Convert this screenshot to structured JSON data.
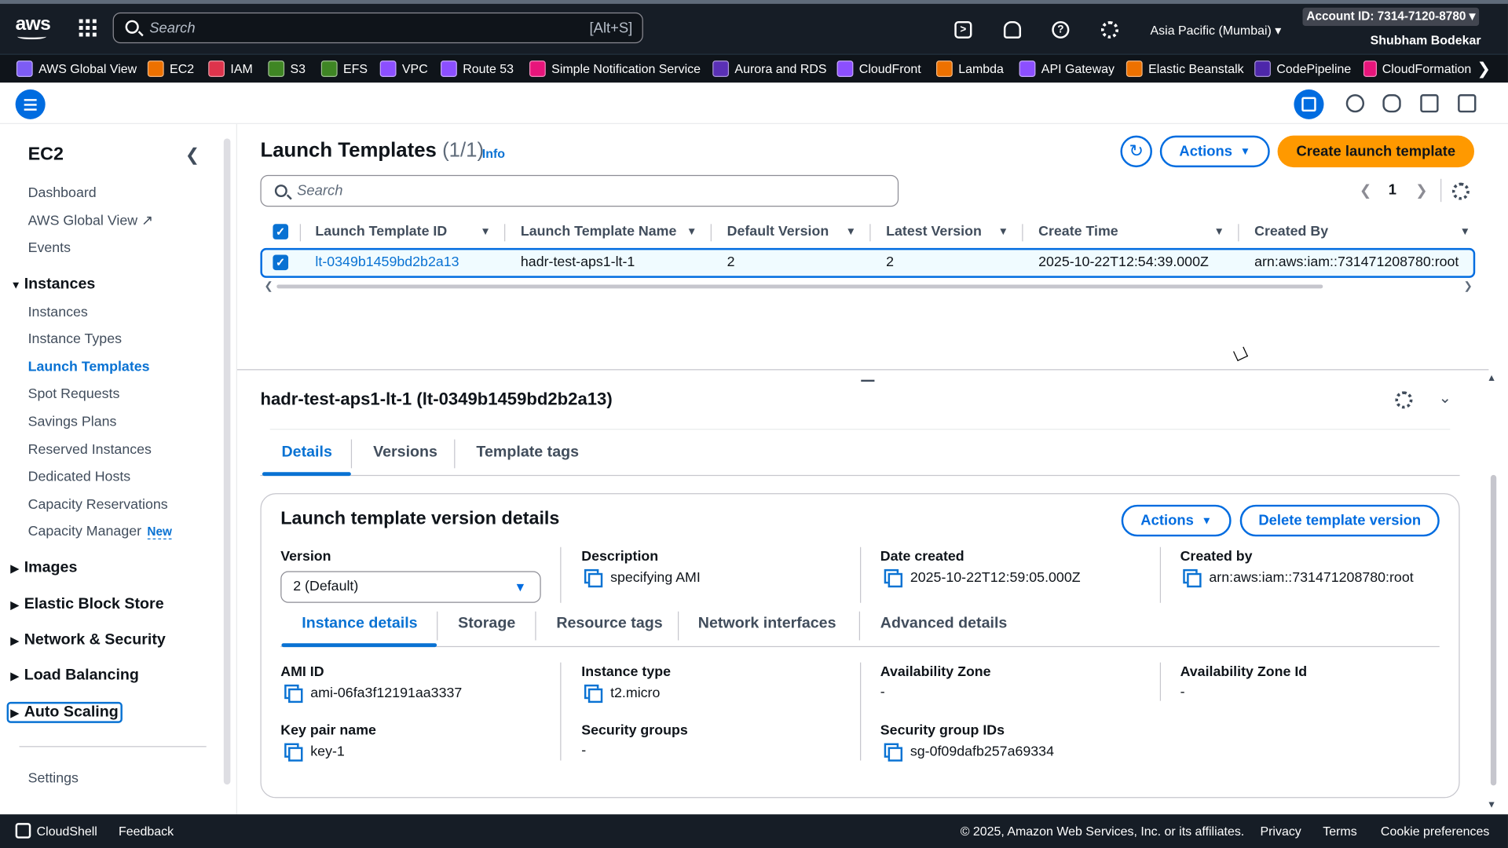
{
  "topnav": {
    "search_placeholder": "Search",
    "search_shortcut": "[Alt+S]",
    "region": "Asia Pacific (Mumbai) ▾",
    "account": "Account ID: 7314-7120-8780 ▾",
    "user": "Shubham Bodekar",
    "icons": [
      "cloudshell-icon",
      "bell-icon",
      "help-icon",
      "gear-icon"
    ]
  },
  "favorites": [
    {
      "label": "AWS Global View",
      "color": "#7d5cf5"
    },
    {
      "label": "EC2",
      "color": "#ed7100"
    },
    {
      "label": "IAM",
      "color": "#dd344c"
    },
    {
      "label": "S3",
      "color": "#3f8624"
    },
    {
      "label": "EFS",
      "color": "#3f8624"
    },
    {
      "label": "VPC",
      "color": "#8c4fff"
    },
    {
      "label": "Route 53",
      "color": "#8c4fff"
    },
    {
      "label": "Simple Notification Service",
      "color": "#e7157b"
    },
    {
      "label": "Aurora and RDS",
      "color": "#5a30b5"
    },
    {
      "label": "CloudFront",
      "color": "#8c4fff"
    },
    {
      "label": "Lambda",
      "color": "#ed7100"
    },
    {
      "label": "API Gateway",
      "color": "#8c4fff"
    },
    {
      "label": "Elastic Beanstalk",
      "color": "#ed7100"
    },
    {
      "label": "CodePipeline",
      "color": "#4d27aa"
    },
    {
      "label": "CloudFormation",
      "color": "#e7157b"
    }
  ],
  "sidebar": {
    "title": "EC2",
    "top_items": [
      "Dashboard",
      "AWS Global View",
      "Events"
    ],
    "instances_section": "Instances",
    "instance_items": [
      "Instances",
      "Instance Types",
      "Launch Templates",
      "Spot Requests",
      "Savings Plans",
      "Reserved Instances",
      "Dedicated Hosts",
      "Capacity Reservations",
      "Capacity Manager"
    ],
    "new_badge": "New",
    "sections": [
      "Images",
      "Elastic Block Store",
      "Network & Security",
      "Load Balancing",
      "Auto Scaling"
    ],
    "settings": "Settings"
  },
  "main": {
    "title": "Launch Templates",
    "count": "(1/1)",
    "info": "Info",
    "actions_label": "Actions",
    "create_label": "Create launch template",
    "search_placeholder": "Search",
    "page": "1",
    "columns": [
      "Launch Template ID",
      "Launch Template Name",
      "Default Version",
      "Latest Version",
      "Create Time",
      "Created By"
    ],
    "rows": [
      [
        "lt-0349b1459bd2b2a13",
        "hadr-test-aps1-lt-1",
        "2",
        "2",
        "2025-10-22T12:54:39.000Z",
        "arn:aws:iam::731471208780:root"
      ]
    ]
  },
  "detail": {
    "title": "hadr-test-aps1-lt-1 (lt-0349b1459bd2b2a13)",
    "tabs": [
      "Details",
      "Versions",
      "Template tags"
    ],
    "card_title": "Launch template version details",
    "actions_label": "Actions",
    "delete_label": "Delete template version",
    "version_label": "Version",
    "version_value": "2 (Default)",
    "description_label": "Description",
    "description_value": "specifying AMI",
    "date_label": "Date created",
    "date_value": "2025-10-22T12:59:05.000Z",
    "createdby_label": "Created by",
    "createdby_value": "arn:aws:iam::731471208780:root",
    "inner_tabs": [
      "Instance details",
      "Storage",
      "Resource tags",
      "Network interfaces",
      "Advanced details"
    ],
    "fields": {
      "ami_label": "AMI ID",
      "ami_value": "ami-06fa3f12191aa3337",
      "type_label": "Instance type",
      "type_value": "t2.micro",
      "az_label": "Availability Zone",
      "az_value": "-",
      "azid_label": "Availability Zone Id",
      "azid_value": "-",
      "key_label": "Key pair name",
      "key_value": "key-1",
      "sg_label": "Security groups",
      "sg_value": "-",
      "sgid_label": "Security group IDs",
      "sgid_value": "sg-0f09dafb257a69334"
    }
  },
  "footer": {
    "cloudshell": "CloudShell",
    "feedback": "Feedback",
    "copyright": "© 2025, Amazon Web Services, Inc. or its affiliates.",
    "privacy": "Privacy",
    "terms": "Terms",
    "cookies": "Cookie preferences"
  }
}
